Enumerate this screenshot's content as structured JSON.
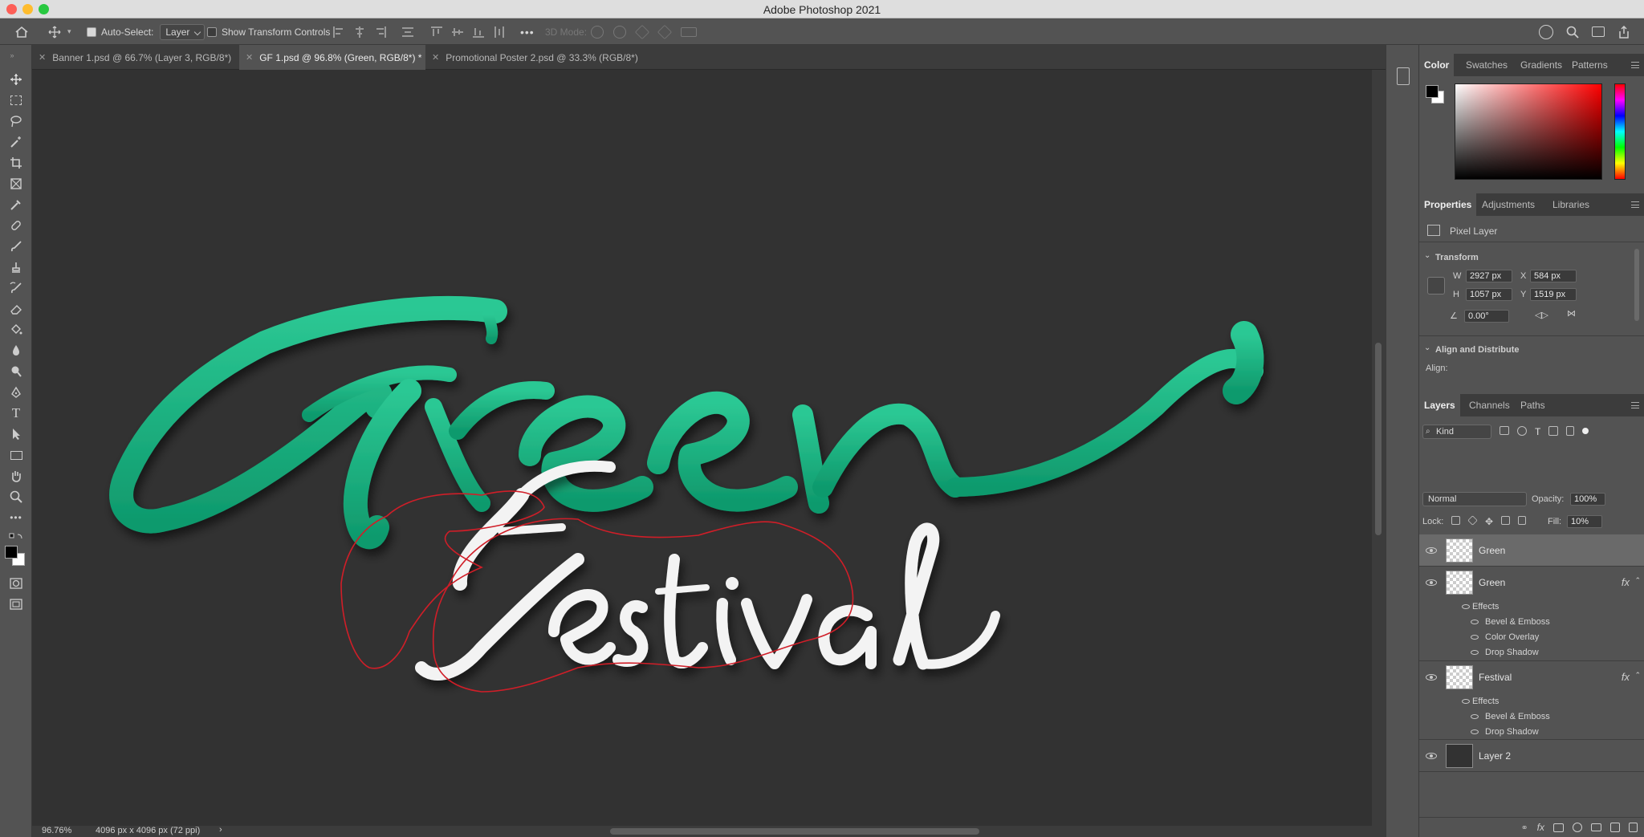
{
  "app": {
    "title": "Adobe Photoshop 2021"
  },
  "colors": {
    "accent_green": "#17b07f",
    "selection_outline": "#d01e28",
    "panel_bg": "#535353",
    "canvas_bg": "#323232"
  },
  "options_bar": {
    "auto_select_label": "Auto-Select:",
    "auto_select_checked": true,
    "auto_select_target": "Layer",
    "show_transform_label": "Show Transform Controls",
    "show_transform_checked": false,
    "mode_3d_label": "3D Mode:",
    "more_label": "•••"
  },
  "tabs": [
    {
      "label": "Banner 1.psd @ 66.7% (Layer 3, RGB/8*)",
      "active": false
    },
    {
      "label": "GF 1.psd @ 96.8% (Green, RGB/8*) *",
      "active": true
    },
    {
      "label": "Promotional Poster 2.psd @ 33.3% (RGB/8*)",
      "active": false
    }
  ],
  "tools": [
    "move-tool-icon",
    "marquee-tool-icon",
    "lasso-tool-icon",
    "magic-wand-icon",
    "crop-tool-icon",
    "frame-tool-icon",
    "eyedropper-icon",
    "healing-brush-icon",
    "brush-tool-icon",
    "clone-stamp-icon",
    "history-brush-icon",
    "eraser-icon",
    "paint-bucket-icon",
    "blur-tool-icon",
    "dodge-tool-icon",
    "pen-tool-icon",
    "type-tool-icon",
    "path-select-icon",
    "rectangle-tool-icon",
    "hand-tool-icon",
    "zoom-tool-icon",
    "more-tools-icon"
  ],
  "canvas": {
    "word_main": "Green",
    "word_sub": "Festival"
  },
  "status": {
    "zoom": "96.76%",
    "doc_size": "4096 px x 4096 px (72 ppi)",
    "arrow": "›"
  },
  "color_panel": {
    "tabs": [
      "Color",
      "Swatches",
      "Gradients",
      "Patterns"
    ],
    "active": "Color"
  },
  "properties_panel": {
    "tabs": [
      "Properties",
      "Adjustments",
      "Libraries"
    ],
    "active": "Properties",
    "kind": "Pixel Layer",
    "transform_heading": "Transform",
    "w_label": "W",
    "w": "2927 px",
    "h_label": "H",
    "h": "1057 px",
    "x_label": "X",
    "x": "584 px",
    "y_label": "Y",
    "y": "1519 px",
    "angle": "0.00°",
    "align_heading": "Align and Distribute",
    "align_label": "Align:"
  },
  "layers_panel": {
    "tabs": [
      "Layers",
      "Channels",
      "Paths"
    ],
    "active": "Layers",
    "filter": "Kind",
    "blend_mode": "Normal",
    "opacity_label": "Opacity:",
    "opacity": "100%",
    "lock_label": "Lock:",
    "fill_label": "Fill:",
    "fill": "10%",
    "layers": [
      {
        "name": "Green",
        "selected": true
      },
      {
        "name": "Green",
        "fx": "fx",
        "effects_label": "Effects",
        "effects": [
          "Bevel & Emboss",
          "Color Overlay",
          "Drop Shadow"
        ]
      },
      {
        "name": "Festival",
        "fx": "fx",
        "effects_label": "Effects",
        "effects": [
          "Bevel & Emboss",
          "Drop Shadow"
        ]
      },
      {
        "name": "Layer 2"
      }
    ]
  }
}
